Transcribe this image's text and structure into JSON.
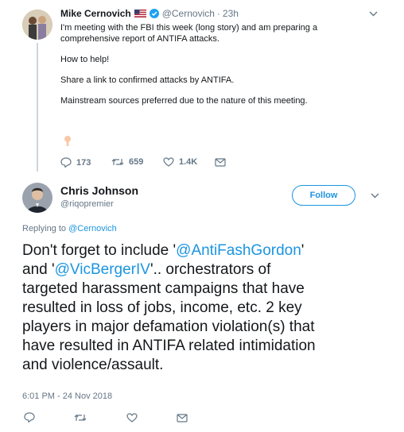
{
  "tweet1": {
    "name": "Mike Cernovich",
    "handle": "@Cernovich",
    "time": "23h",
    "lines": [
      "I'm meeting with the FBI this week (long story) and am preparing a",
      "comprehensive report of ANTIFA attacks.",
      "How to help!",
      "Share a link to confirmed attacks by ANTIFA.",
      "Mainstream sources preferred due to the nature of this meeting."
    ],
    "replies": "173",
    "retweets": "659",
    "likes": "1.4K"
  },
  "tweet2": {
    "name": "Chris Johnson",
    "handle": "@riqopremier",
    "follow_label": "Follow",
    "replying_prefix": "Replying to",
    "replying_handle": "@Cernovich",
    "body": {
      "p1": "Don't forget to include '",
      "m1": "@AntiFashGordon",
      "p2": "'",
      "p3": "and '",
      "m2": "@VicBergerIV",
      "p4": "'.. orchestrators of",
      "l3": "targeted harassment campaigns that have",
      "l4": "resulted in loss of jobs, income, etc. 2 key",
      "l5": "players in major defamation violation(s) that",
      "l6": "have resulted in ANTIFA related intimidation",
      "l7": "and violence/assault."
    },
    "timestamp": "6:01 PM - 24 Nov 2018"
  },
  "colors": {
    "accent": "#1b95e0",
    "muted": "#657786",
    "text": "#14171a",
    "thread_line": "#ccd6dd"
  },
  "icons": [
    "verified-icon",
    "us-flag-icon",
    "reply-icon",
    "retweet-icon",
    "like-icon",
    "message-icon",
    "chevron-down-icon",
    "emoji-icon"
  ]
}
